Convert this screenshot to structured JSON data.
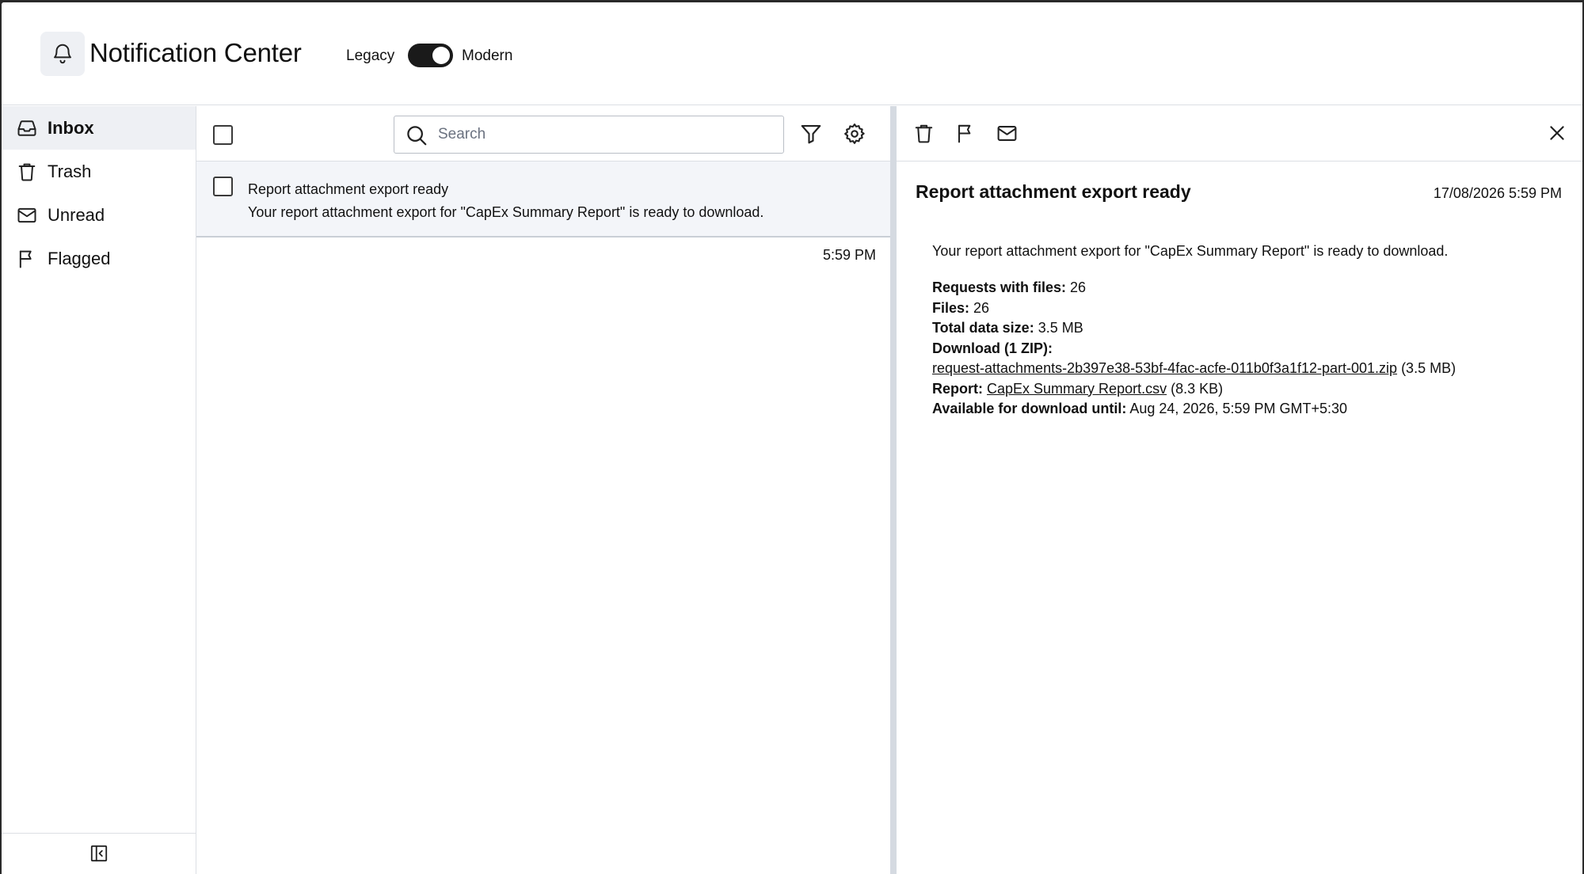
{
  "header": {
    "title": "Notification Center",
    "toggle": {
      "left_label": "Legacy",
      "right_label": "Modern",
      "state": "Modern"
    }
  },
  "sidebar": {
    "items": [
      {
        "label": "Inbox",
        "icon": "inbox-icon",
        "active": true
      },
      {
        "label": "Trash",
        "icon": "trash-icon"
      },
      {
        "label": "Unread",
        "icon": "mail-icon"
      },
      {
        "label": "Flagged",
        "icon": "flag-icon"
      }
    ],
    "footer_icon": "collapse-sidebar-icon"
  },
  "list": {
    "search": {
      "placeholder": "Search",
      "value": ""
    },
    "messages": [
      {
        "subject": "Report attachment export ready",
        "preview": "Your report attachment export for \"CapEx Summary Report\" is ready to download.",
        "time": "5:59 PM"
      }
    ]
  },
  "detail": {
    "title": "Report attachment export ready",
    "date": "17/08/2026 5:59 PM",
    "intro": "Your report attachment export for \"CapEx Summary Report\" is ready to download.",
    "requests_label": "Requests with files:",
    "requests_value": "26",
    "files_label": "Files:",
    "files_value": "26",
    "size_label": "Total data size:",
    "size_value": "3.5 MB",
    "download_label": "Download (1 ZIP):",
    "zip_link": "request-attachments-2b397e38-53bf-4fac-acfe-011b0f3a1f12-part-001.zip",
    "zip_size": "(3.5 MB)",
    "report_label": "Report:",
    "report_link": "CapEx Summary Report.csv",
    "report_size": "(8.3 KB)",
    "available_label": "Available for download until:",
    "available_value": "Aug 24, 2026, 5:59 PM GMT+5:30"
  },
  "colors": {
    "active_bg": "#eef0f4",
    "selected_row_bg": "#f3f5f9",
    "toggle_on": "#1a1a1a",
    "border": "#dcdfe4"
  }
}
